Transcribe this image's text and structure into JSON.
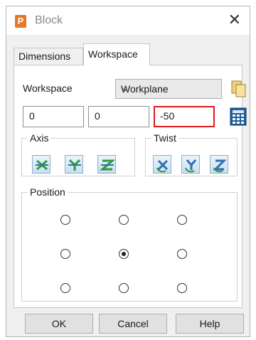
{
  "window": {
    "title": "Block",
    "app_icon_letter": "P"
  },
  "tabs": [
    {
      "label": "Dimensions"
    },
    {
      "label": "Workspace"
    }
  ],
  "workspace": {
    "label": "Workspace",
    "select_value": "Workplane",
    "inputs": [
      "0",
      "0",
      "-50"
    ]
  },
  "axis": {
    "label": "Axis",
    "buttons": [
      "x-axis-icon",
      "y-axis-icon",
      "z-axis-icon"
    ]
  },
  "twist": {
    "label": "Twist",
    "buttons": [
      "twist-x-icon",
      "twist-y-icon",
      "twist-z-icon"
    ]
  },
  "position": {
    "label": "Position",
    "selected_index": 4
  },
  "buttons": {
    "ok": "OK",
    "cancel": "Cancel",
    "help": "Help"
  },
  "colors": {
    "accent_red": "#e01818",
    "icon_green": "#2e9a3e",
    "icon_blue": "#2f6fb5"
  }
}
